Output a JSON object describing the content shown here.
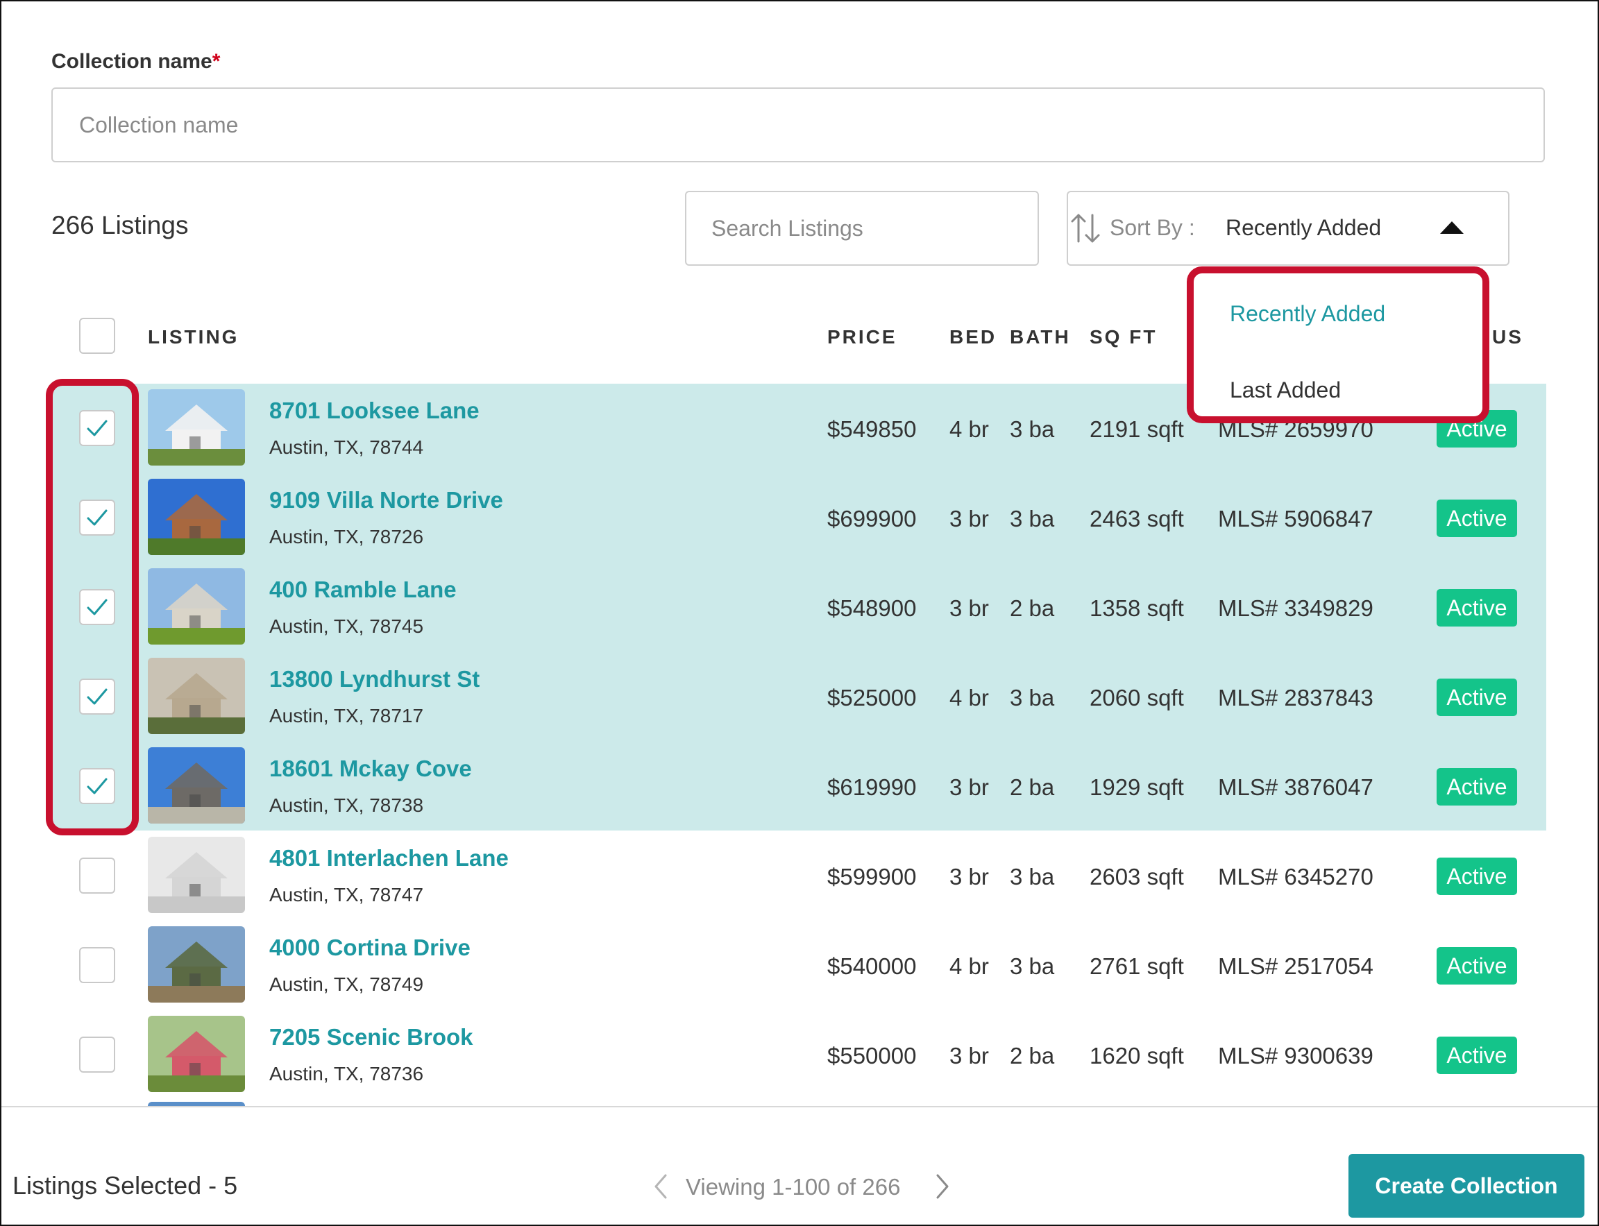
{
  "form": {
    "name_label": "Collection name",
    "required_mark": "*",
    "name_placeholder": "Collection name",
    "name_value": ""
  },
  "listings_count": "266 Listings",
  "search": {
    "placeholder": "Search Listings"
  },
  "sort": {
    "label": "Sort By :",
    "selected": "Recently Added",
    "options": [
      "Recently Added",
      "Last Added"
    ],
    "active_color": "#1d98a1"
  },
  "table": {
    "headers": {
      "listing": "LISTING",
      "price": "PRICE",
      "bed": "BED",
      "bath": "BATH",
      "sqft": "SQ FT",
      "status_partial": "US"
    },
    "rows": [
      {
        "address": "8701 Looksee Lane",
        "city": "Austin, TX, 78744",
        "price": "$549850",
        "bed": "4 br",
        "bath": "3 ba",
        "sqft": "2191 sqft",
        "mls": "MLS# 2659970",
        "status": "Active",
        "selected": true,
        "thumb_colors": [
          "#9ec9ea",
          "#f2f2f2",
          "#6b8e3d"
        ]
      },
      {
        "address": "9109 Villa Norte Drive",
        "city": "Austin, TX, 78726",
        "price": "$699900",
        "bed": "3 br",
        "bath": "3 ba",
        "sqft": "2463 sqft",
        "mls": "MLS# 5906847",
        "status": "Active",
        "selected": true,
        "thumb_colors": [
          "#2f6fd1",
          "#a8683f",
          "#4f7a2a"
        ]
      },
      {
        "address": "400 Ramble Lane",
        "city": "Austin, TX, 78745",
        "price": "$548900",
        "bed": "3 br",
        "bath": "2 ba",
        "sqft": "1358 sqft",
        "mls": "MLS# 3349829",
        "status": "Active",
        "selected": true,
        "thumb_colors": [
          "#8fb9e3",
          "#d9d4c8",
          "#6f9a2e"
        ]
      },
      {
        "address": "13800 Lyndhurst St",
        "city": "Austin, TX, 78717",
        "price": "$525000",
        "bed": "4 br",
        "bath": "3 ba",
        "sqft": "2060 sqft",
        "mls": "MLS# 2837843",
        "status": "Active",
        "selected": true,
        "thumb_colors": [
          "#c9c2b4",
          "#b7a88f",
          "#5a6e3a"
        ]
      },
      {
        "address": "18601 Mckay Cove",
        "city": "Austin, TX, 78738",
        "price": "$619990",
        "bed": "3 br",
        "bath": "2 ba",
        "sqft": "1929 sqft",
        "mls": "MLS# 3876047",
        "status": "Active",
        "selected": true,
        "thumb_colors": [
          "#3d7fd6",
          "#6d6a66",
          "#b9b6a8"
        ]
      },
      {
        "address": "4801 Interlachen Lane",
        "city": "Austin, TX, 78747",
        "price": "$599900",
        "bed": "3 br",
        "bath": "3 ba",
        "sqft": "2603 sqft",
        "mls": "MLS# 6345270",
        "status": "Active",
        "selected": false,
        "thumb_colors": [
          "#e8e8e8",
          "#d5d5d5",
          "#c8c8c8"
        ]
      },
      {
        "address": "4000 Cortina Drive",
        "city": "Austin, TX, 78749",
        "price": "$540000",
        "bed": "4 br",
        "bath": "3 ba",
        "sqft": "2761 sqft",
        "mls": "MLS# 2517054",
        "status": "Active",
        "selected": false,
        "thumb_colors": [
          "#7ea2c9",
          "#5b6a44",
          "#8d7a5a"
        ]
      },
      {
        "address": "7205 Scenic Brook",
        "city": "Austin, TX, 78736",
        "price": "$550000",
        "bed": "3 br",
        "bath": "2 ba",
        "sqft": "1620 sqft",
        "mls": "MLS# 9300639",
        "status": "Active",
        "selected": false,
        "thumb_colors": [
          "#a7c48a",
          "#d45a6a",
          "#6b8c3a"
        ]
      }
    ]
  },
  "footer": {
    "selected_text": "Listings Selected - 5",
    "pager_text": "Viewing 1-100 of 266",
    "create_button": "Create Collection"
  },
  "icons": {
    "sort": "sort-arrows-icon",
    "caret": "caret-up-icon",
    "check": "checkmark-icon",
    "prev": "chevron-left-icon",
    "next": "chevron-right-icon"
  }
}
